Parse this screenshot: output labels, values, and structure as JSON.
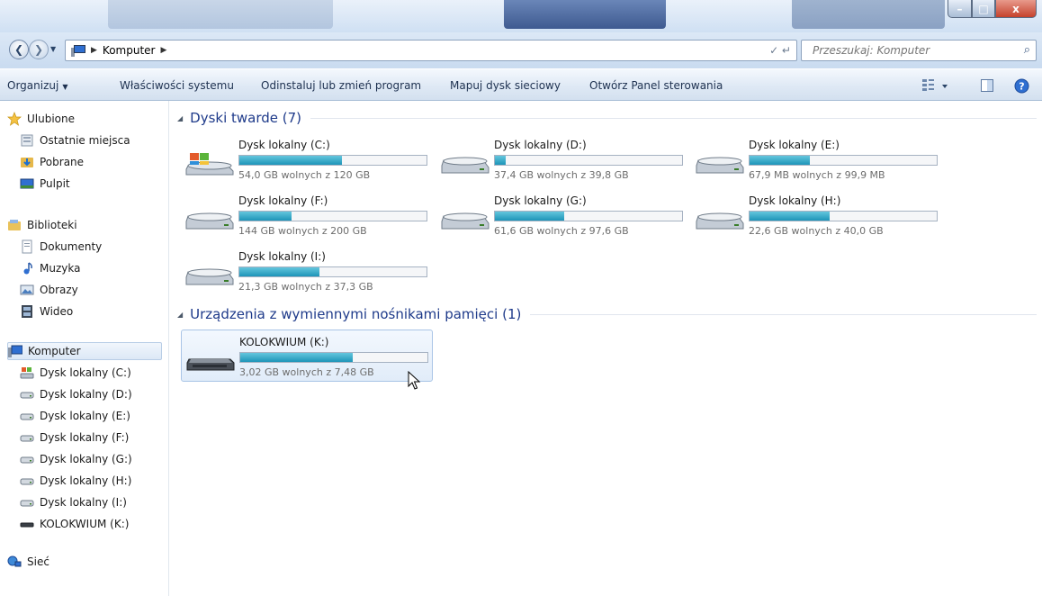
{
  "window": {
    "controls": {
      "minimize": "–",
      "maximize": "□",
      "close": "x"
    }
  },
  "address": {
    "crumbs": [
      "Komputer"
    ],
    "search_placeholder": "Przeszukaj: Komputer"
  },
  "commands": {
    "organize": "Organizuj",
    "system_properties": "Właściwości systemu",
    "uninstall": "Odinstaluj lub zmień program",
    "map_drive": "Mapuj dysk sieciowy",
    "control_panel": "Otwórz Panel sterowania"
  },
  "nav": {
    "favorites": {
      "label": "Ulubione",
      "items": [
        "Ostatnie miejsca",
        "Pobrane",
        "Pulpit"
      ]
    },
    "libraries": {
      "label": "Biblioteki",
      "items": [
        "Dokumenty",
        "Muzyka",
        "Obrazy",
        "Wideo"
      ]
    },
    "computer": {
      "label": "Komputer",
      "items": [
        "Dysk lokalny (C:)",
        "Dysk lokalny (D:)",
        "Dysk lokalny (E:)",
        "Dysk lokalny (F:)",
        "Dysk lokalny (G:)",
        "Dysk lokalny (H:)",
        "Dysk lokalny (I:)",
        "KOLOKWIUM (K:)"
      ]
    },
    "network": {
      "label": "Sieć"
    }
  },
  "groups": {
    "hard_drives": {
      "title": "Dyski twarde (7)",
      "drives": [
        {
          "name": "Dysk lokalny (C:)",
          "free_text": "54,0 GB wolnych z 120 GB",
          "used_fraction": 0.55,
          "system": true
        },
        {
          "name": "Dysk lokalny (D:)",
          "free_text": "37,4 GB wolnych z 39,8 GB",
          "used_fraction": 0.06
        },
        {
          "name": "Dysk lokalny (E:)",
          "free_text": "67,9 MB wolnych z 99,9 MB",
          "used_fraction": 0.32
        },
        {
          "name": "Dysk lokalny (F:)",
          "free_text": "144 GB wolnych z 200 GB",
          "used_fraction": 0.28
        },
        {
          "name": "Dysk lokalny (G:)",
          "free_text": "61,6 GB wolnych z 97,6 GB",
          "used_fraction": 0.37
        },
        {
          "name": "Dysk lokalny (H:)",
          "free_text": "22,6 GB wolnych z 40,0 GB",
          "used_fraction": 0.43
        },
        {
          "name": "Dysk lokalny (I:)",
          "free_text": "21,3 GB wolnych z 37,3 GB",
          "used_fraction": 0.43
        }
      ]
    },
    "removable": {
      "title": "Urządzenia z wymiennymi nośnikami pamięci (1)",
      "drives": [
        {
          "name": "KOLOKWIUM (K:)",
          "free_text": "3,02 GB wolnych z 7,48 GB",
          "used_fraction": 0.6
        }
      ]
    }
  },
  "colors": {
    "bar_fill": "#1d95b8",
    "group_title": "#1e3a8a",
    "selection": "#dce8f6"
  }
}
